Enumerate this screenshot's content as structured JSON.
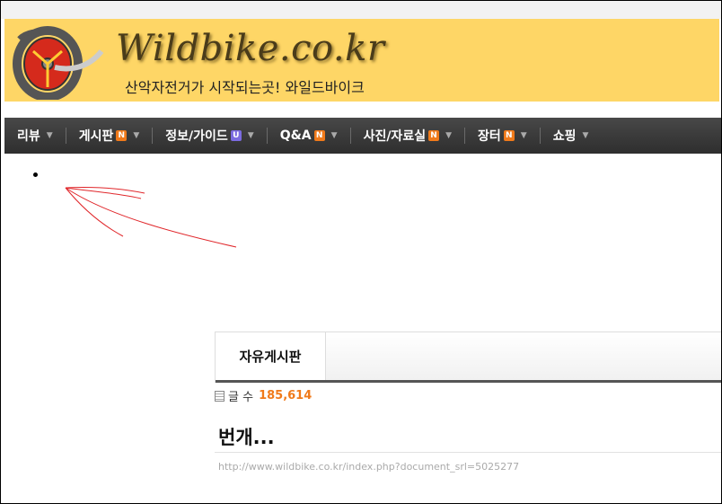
{
  "site": {
    "logo_text": "Wildbike.co.kr",
    "tagline": "산악자전거가 시작되는곳! 와일드바이크"
  },
  "nav": {
    "items": [
      {
        "label": "리뷰",
        "badge": ""
      },
      {
        "label": "게시판",
        "badge": "N"
      },
      {
        "label": "정보/가이드",
        "badge": "U"
      },
      {
        "label": "Q&A",
        "badge": "N"
      },
      {
        "label": "사진/자료실",
        "badge": "N"
      },
      {
        "label": "장터",
        "badge": "N"
      },
      {
        "label": "쇼핑",
        "badge": ""
      }
    ]
  },
  "board": {
    "tab_label": "자유게시판",
    "count_label": "글 수",
    "count_value": "185,614"
  },
  "post": {
    "title": "번개...",
    "url": "http://www.wildbike.co.kr/index.php?document_srl=5025277"
  },
  "colors": {
    "banner": "#fed666",
    "nav_bg": "#3a3a3a",
    "accent_orange": "#f07a1a",
    "accent_red": "#e8451e",
    "badge_u": "#7b6be0"
  }
}
